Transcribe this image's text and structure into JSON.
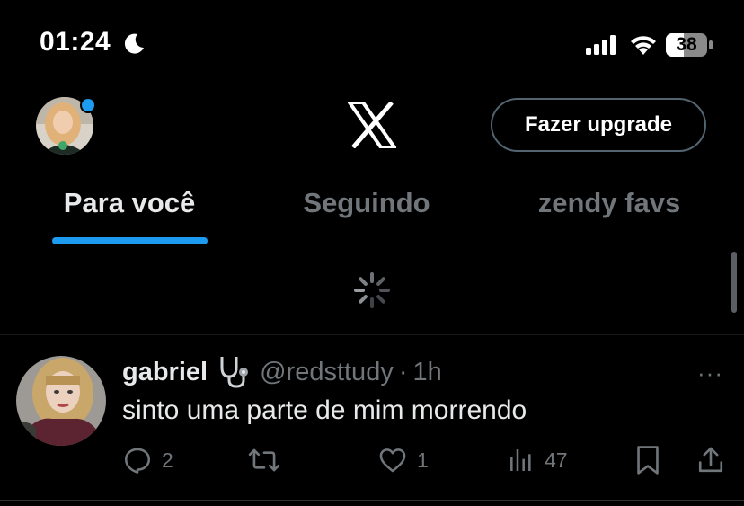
{
  "status_bar": {
    "time": "01:24",
    "battery": "38",
    "icons": [
      "moon-icon",
      "signal-icon",
      "wifi-icon",
      "battery-icon"
    ]
  },
  "header": {
    "logo": "x-logo",
    "upgrade_label": "Fazer upgrade",
    "avatar": "user-avatar"
  },
  "tabs": [
    {
      "label": "Para você",
      "active": true
    },
    {
      "label": "Seguindo",
      "active": false
    },
    {
      "label": "zendy favs",
      "active": false
    }
  ],
  "tweet": {
    "name": "gabriel",
    "name_emoji": "stethoscope-emoji",
    "handle": "@redsttudy",
    "separator": "·",
    "time": "1h",
    "text": "sinto uma parte de mim morrendo",
    "more": "···",
    "actions": {
      "replies": "2",
      "retweets": "",
      "likes": "1",
      "views": "47"
    }
  },
  "colors": {
    "accent": "#1d9bf0",
    "muted": "#71767b",
    "text": "#e7e9ea",
    "background": "#000000",
    "border": "#2f3336"
  }
}
